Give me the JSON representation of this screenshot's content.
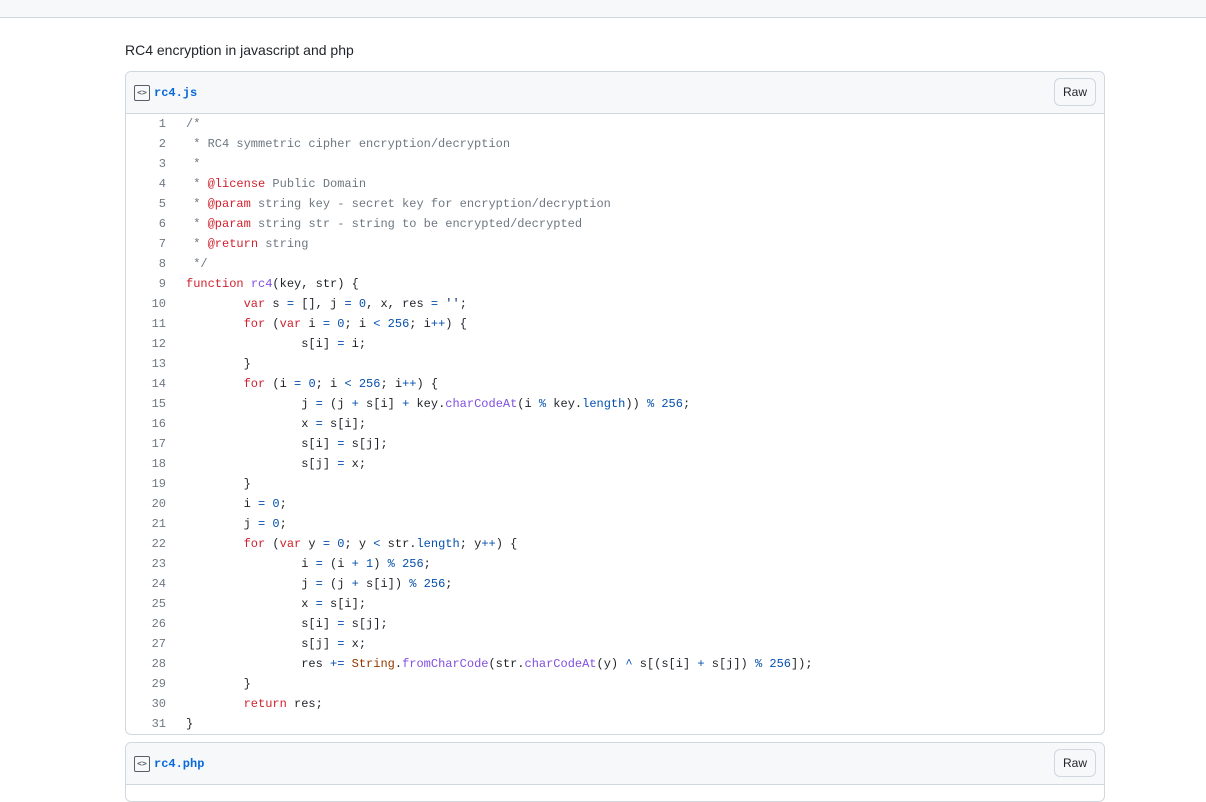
{
  "description": "RC4 encryption in javascript and php",
  "files": [
    {
      "name": "rc4.js",
      "raw_label": "Raw",
      "lines": [
        [
          [
            "c",
            "/*"
          ]
        ],
        [
          [
            "c",
            " * RC4 symmetric cipher encryption/decryption"
          ]
        ],
        [
          [
            "c",
            " *"
          ]
        ],
        [
          [
            "c",
            " * "
          ],
          [
            "k",
            "@license"
          ],
          [
            "c",
            " Public Domain"
          ]
        ],
        [
          [
            "c",
            " * "
          ],
          [
            "k",
            "@param"
          ],
          [
            "c",
            " string key - secret key for encryption/decryption"
          ]
        ],
        [
          [
            "c",
            " * "
          ],
          [
            "k",
            "@param"
          ],
          [
            "c",
            " string str - string to be encrypted/decrypted"
          ]
        ],
        [
          [
            "c",
            " * "
          ],
          [
            "k",
            "@return"
          ],
          [
            "c",
            " string"
          ]
        ],
        [
          [
            "c",
            " */"
          ]
        ],
        [
          [
            "k",
            "function"
          ],
          [
            "t",
            " "
          ],
          [
            "f",
            "rc4"
          ],
          [
            "t",
            "(key, str) {"
          ]
        ],
        [
          [
            "t",
            "        "
          ],
          [
            "k",
            "var"
          ],
          [
            "t",
            " s "
          ],
          [
            "n",
            "="
          ],
          [
            "t",
            " [], j "
          ],
          [
            "n",
            "="
          ],
          [
            "t",
            " "
          ],
          [
            "n",
            "0"
          ],
          [
            "t",
            ", x, res "
          ],
          [
            "n",
            "="
          ],
          [
            "t",
            " "
          ],
          [
            "s",
            "''"
          ],
          [
            "t",
            ";"
          ]
        ],
        [
          [
            "t",
            "        "
          ],
          [
            "k",
            "for"
          ],
          [
            "t",
            " ("
          ],
          [
            "k",
            "var"
          ],
          [
            "t",
            " i "
          ],
          [
            "n",
            "="
          ],
          [
            "t",
            " "
          ],
          [
            "n",
            "0"
          ],
          [
            "t",
            "; i "
          ],
          [
            "n",
            "<"
          ],
          [
            "t",
            " "
          ],
          [
            "n",
            "256"
          ],
          [
            "t",
            "; i"
          ],
          [
            "n",
            "++"
          ],
          [
            "t",
            ") {"
          ]
        ],
        [
          [
            "t",
            "                s[i] "
          ],
          [
            "n",
            "="
          ],
          [
            "t",
            " i;"
          ]
        ],
        [
          [
            "t",
            "        }"
          ]
        ],
        [
          [
            "t",
            "        "
          ],
          [
            "k",
            "for"
          ],
          [
            "t",
            " (i "
          ],
          [
            "n",
            "="
          ],
          [
            "t",
            " "
          ],
          [
            "n",
            "0"
          ],
          [
            "t",
            "; i "
          ],
          [
            "n",
            "<"
          ],
          [
            "t",
            " "
          ],
          [
            "n",
            "256"
          ],
          [
            "t",
            "; i"
          ],
          [
            "n",
            "++"
          ],
          [
            "t",
            ") {"
          ]
        ],
        [
          [
            "t",
            "                j "
          ],
          [
            "n",
            "="
          ],
          [
            "t",
            " (j "
          ],
          [
            "n",
            "+"
          ],
          [
            "t",
            " s[i] "
          ],
          [
            "n",
            "+"
          ],
          [
            "t",
            " key."
          ],
          [
            "f",
            "charCodeAt"
          ],
          [
            "t",
            "(i "
          ],
          [
            "n",
            "%"
          ],
          [
            "t",
            " key."
          ],
          [
            "n",
            "length"
          ],
          [
            "t",
            ")) "
          ],
          [
            "n",
            "%"
          ],
          [
            "t",
            " "
          ],
          [
            "n",
            "256"
          ],
          [
            "t",
            ";"
          ]
        ],
        [
          [
            "t",
            "                x "
          ],
          [
            "n",
            "="
          ],
          [
            "t",
            " s[i];"
          ]
        ],
        [
          [
            "t",
            "                s[i] "
          ],
          [
            "n",
            "="
          ],
          [
            "t",
            " s[j];"
          ]
        ],
        [
          [
            "t",
            "                s[j] "
          ],
          [
            "n",
            "="
          ],
          [
            "t",
            " x;"
          ]
        ],
        [
          [
            "t",
            "        }"
          ]
        ],
        [
          [
            "t",
            "        i "
          ],
          [
            "n",
            "="
          ],
          [
            "t",
            " "
          ],
          [
            "n",
            "0"
          ],
          [
            "t",
            ";"
          ]
        ],
        [
          [
            "t",
            "        j "
          ],
          [
            "n",
            "="
          ],
          [
            "t",
            " "
          ],
          [
            "n",
            "0"
          ],
          [
            "t",
            ";"
          ]
        ],
        [
          [
            "t",
            "        "
          ],
          [
            "k",
            "for"
          ],
          [
            "t",
            " ("
          ],
          [
            "k",
            "var"
          ],
          [
            "t",
            " y "
          ],
          [
            "n",
            "="
          ],
          [
            "t",
            " "
          ],
          [
            "n",
            "0"
          ],
          [
            "t",
            "; y "
          ],
          [
            "n",
            "<"
          ],
          [
            "t",
            " str."
          ],
          [
            "n",
            "length"
          ],
          [
            "t",
            "; y"
          ],
          [
            "n",
            "++"
          ],
          [
            "t",
            ") {"
          ]
        ],
        [
          [
            "t",
            "                i "
          ],
          [
            "n",
            "="
          ],
          [
            "t",
            " (i "
          ],
          [
            "n",
            "+"
          ],
          [
            "t",
            " "
          ],
          [
            "n",
            "1"
          ],
          [
            "t",
            ") "
          ],
          [
            "n",
            "%"
          ],
          [
            "t",
            " "
          ],
          [
            "n",
            "256"
          ],
          [
            "t",
            ";"
          ]
        ],
        [
          [
            "t",
            "                j "
          ],
          [
            "n",
            "="
          ],
          [
            "t",
            " (j "
          ],
          [
            "n",
            "+"
          ],
          [
            "t",
            " s[i]) "
          ],
          [
            "n",
            "%"
          ],
          [
            "t",
            " "
          ],
          [
            "n",
            "256"
          ],
          [
            "t",
            ";"
          ]
        ],
        [
          [
            "t",
            "                x "
          ],
          [
            "n",
            "="
          ],
          [
            "t",
            " s[i];"
          ]
        ],
        [
          [
            "t",
            "                s[i] "
          ],
          [
            "n",
            "="
          ],
          [
            "t",
            " s[j];"
          ]
        ],
        [
          [
            "t",
            "                s[j] "
          ],
          [
            "n",
            "="
          ],
          [
            "t",
            " x;"
          ]
        ],
        [
          [
            "t",
            "                res "
          ],
          [
            "n",
            "+="
          ],
          [
            "t",
            " "
          ],
          [
            "e",
            "String"
          ],
          [
            "t",
            "."
          ],
          [
            "f",
            "fromCharCode"
          ],
          [
            "t",
            "(str."
          ],
          [
            "f",
            "charCodeAt"
          ],
          [
            "t",
            "(y) "
          ],
          [
            "n",
            "^"
          ],
          [
            "t",
            " s[(s[i] "
          ],
          [
            "n",
            "+"
          ],
          [
            "t",
            " s[j]) "
          ],
          [
            "n",
            "%"
          ],
          [
            "t",
            " "
          ],
          [
            "n",
            "256"
          ],
          [
            "t",
            "]);"
          ]
        ],
        [
          [
            "t",
            "        }"
          ]
        ],
        [
          [
            "t",
            "        "
          ],
          [
            "k",
            "return"
          ],
          [
            "t",
            " res;"
          ]
        ],
        [
          [
            "t",
            "}"
          ]
        ]
      ]
    },
    {
      "name": "rc4.php",
      "raw_label": "Raw",
      "lines": []
    }
  ]
}
